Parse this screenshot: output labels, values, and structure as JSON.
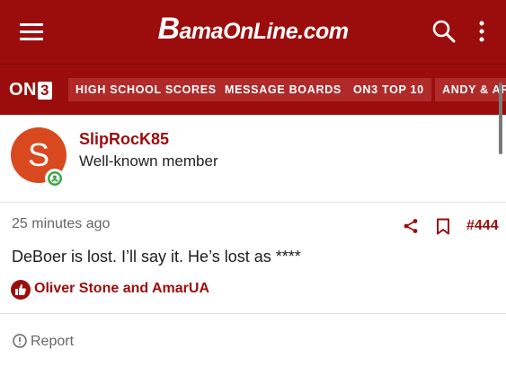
{
  "header": {
    "logo_initial": "B",
    "logo_rest": "amaOnLine.com"
  },
  "nav": {
    "brand_prefix": "ON",
    "brand_digit": "3",
    "items": [
      {
        "label": "HIGH SCHOOL SCORES"
      },
      {
        "label": "MESSAGE BOARDS"
      },
      {
        "label": "ON3 TOP 10"
      },
      {
        "label": "ANDY & ARI"
      }
    ]
  },
  "member": {
    "avatar_letter": "S",
    "username": "SlipRocK85",
    "title": "Well-known member"
  },
  "post": {
    "time": "25 minutes ago",
    "number": "#444",
    "body": "DeBoer is lost. I’ll say it. He’s lost as ****",
    "reactions": "Oliver Stone and AmarUA",
    "report_label": "Report"
  },
  "colors": {
    "brand": "#9b0d0d",
    "avatar": "#d9491f",
    "online": "#3aa84a"
  },
  "icons": [
    "menu-icon",
    "search-icon",
    "kebab-icon",
    "online-status-icon",
    "share-icon",
    "bookmark-icon",
    "thumbs-up-icon",
    "report-icon"
  ]
}
